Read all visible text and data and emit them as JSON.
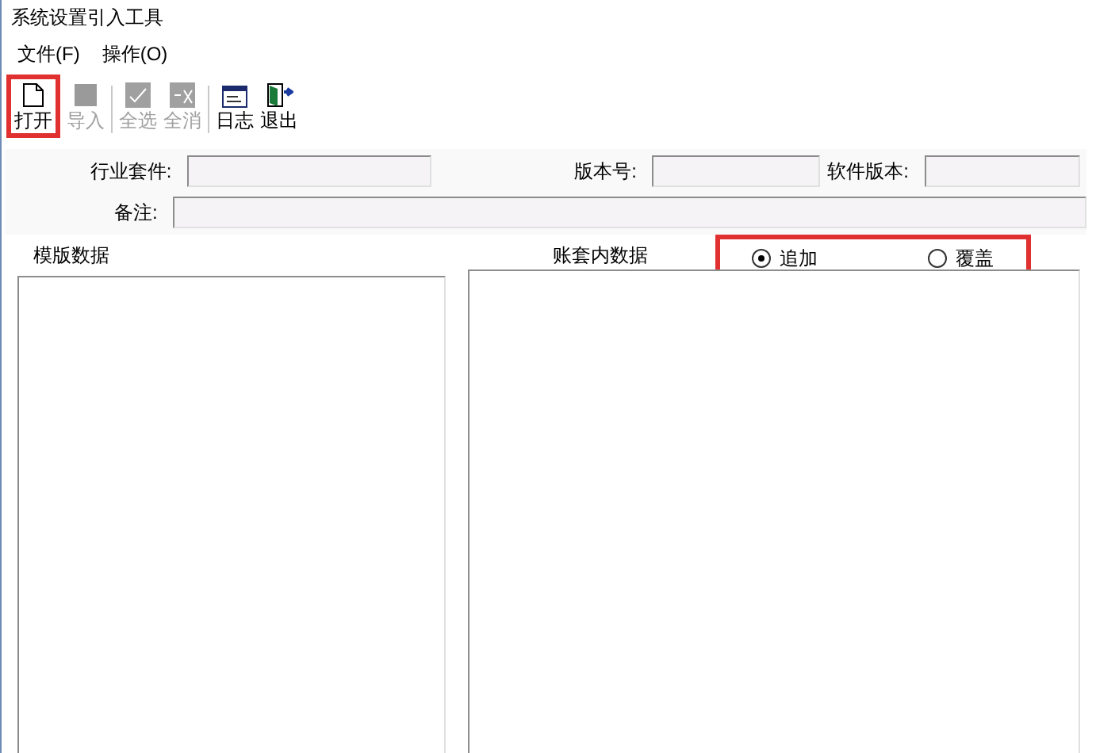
{
  "window": {
    "title": "系统设置引入工具"
  },
  "menu": [
    "文件(F)",
    "操作(O)"
  ],
  "toolbar": [
    {
      "label": "打开",
      "kind": "file",
      "disabled": false,
      "highlighted": true
    },
    {
      "label": "导入",
      "kind": "import",
      "disabled": true,
      "highlighted": false
    },
    {
      "label": "全选",
      "kind": "check",
      "disabled": true,
      "highlighted": false
    },
    {
      "label": "全消",
      "kind": "uncheck",
      "disabled": true,
      "highlighted": false
    },
    {
      "label": "日志",
      "kind": "log",
      "disabled": false,
      "highlighted": false
    },
    {
      "label": "退出",
      "kind": "exit",
      "disabled": false,
      "highlighted": false
    }
  ],
  "fields": {
    "industry_suite": {
      "label": "行业套件:"
    },
    "version": {
      "label": "版本号:"
    },
    "software_version": {
      "label": "软件版本:"
    },
    "note": {
      "label": "备注:"
    }
  },
  "template_panel": {
    "title": "模版数据"
  },
  "account_panel": {
    "title": "账套内数据"
  },
  "mode": {
    "highlighted": true,
    "options": [
      {
        "label": "追加",
        "selected": true
      },
      {
        "label": "覆盖",
        "selected": false
      }
    ]
  }
}
